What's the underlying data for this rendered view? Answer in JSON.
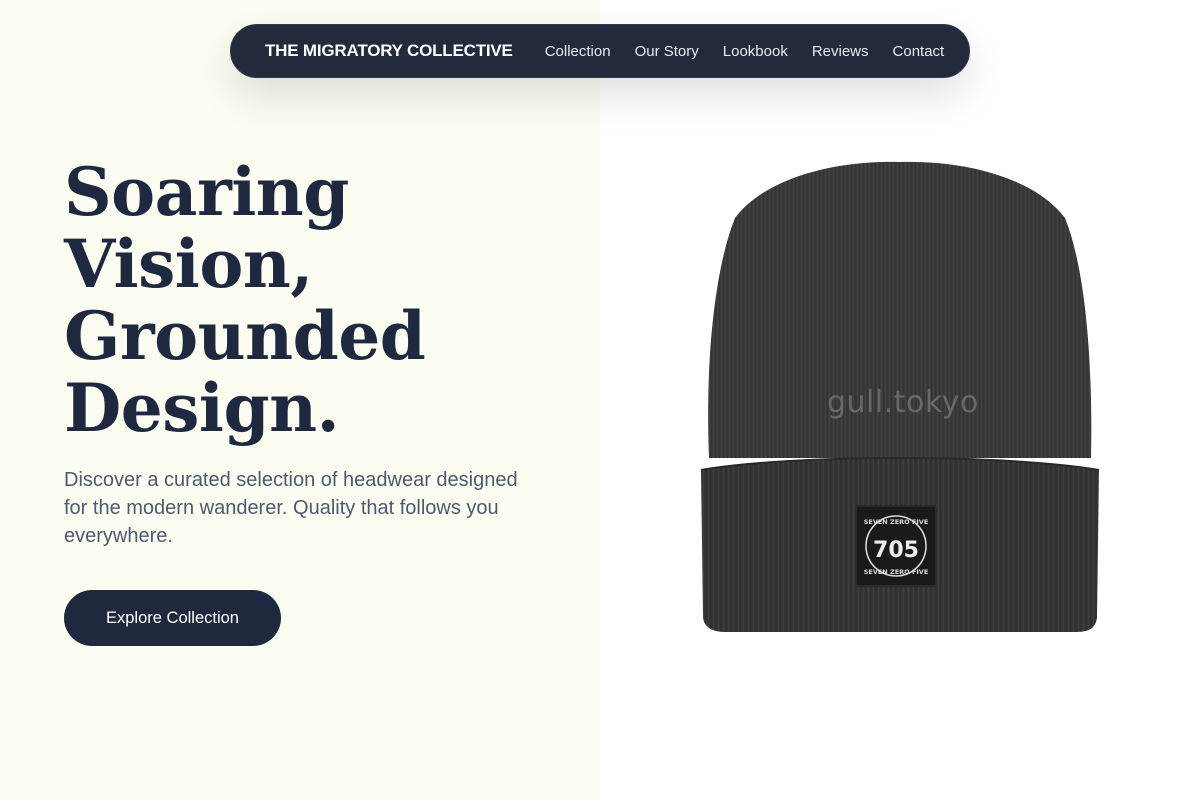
{
  "nav": {
    "brand": "THE MIGRATORY COLLECTIVE",
    "links": [
      "Collection",
      "Our Story",
      "Lookbook",
      "Reviews",
      "Contact"
    ]
  },
  "hero": {
    "headline_lines": [
      "Soaring",
      "Vision,",
      "Grounded",
      "Design."
    ],
    "subtext": "Discover a curated selection of headwear designed for the modern wanderer. Quality that follows you everywhere.",
    "cta_label": "Explore Collection"
  },
  "product": {
    "watermark": "gull.tokyo",
    "patch_top": "SEVEN ZERO FIVE",
    "patch_number": "705",
    "patch_bottom": "SEVEN ZERO FIVE"
  },
  "colors": {
    "navy": "#1e2940",
    "cream": "#fcfdf1",
    "beanie": "#383838"
  }
}
